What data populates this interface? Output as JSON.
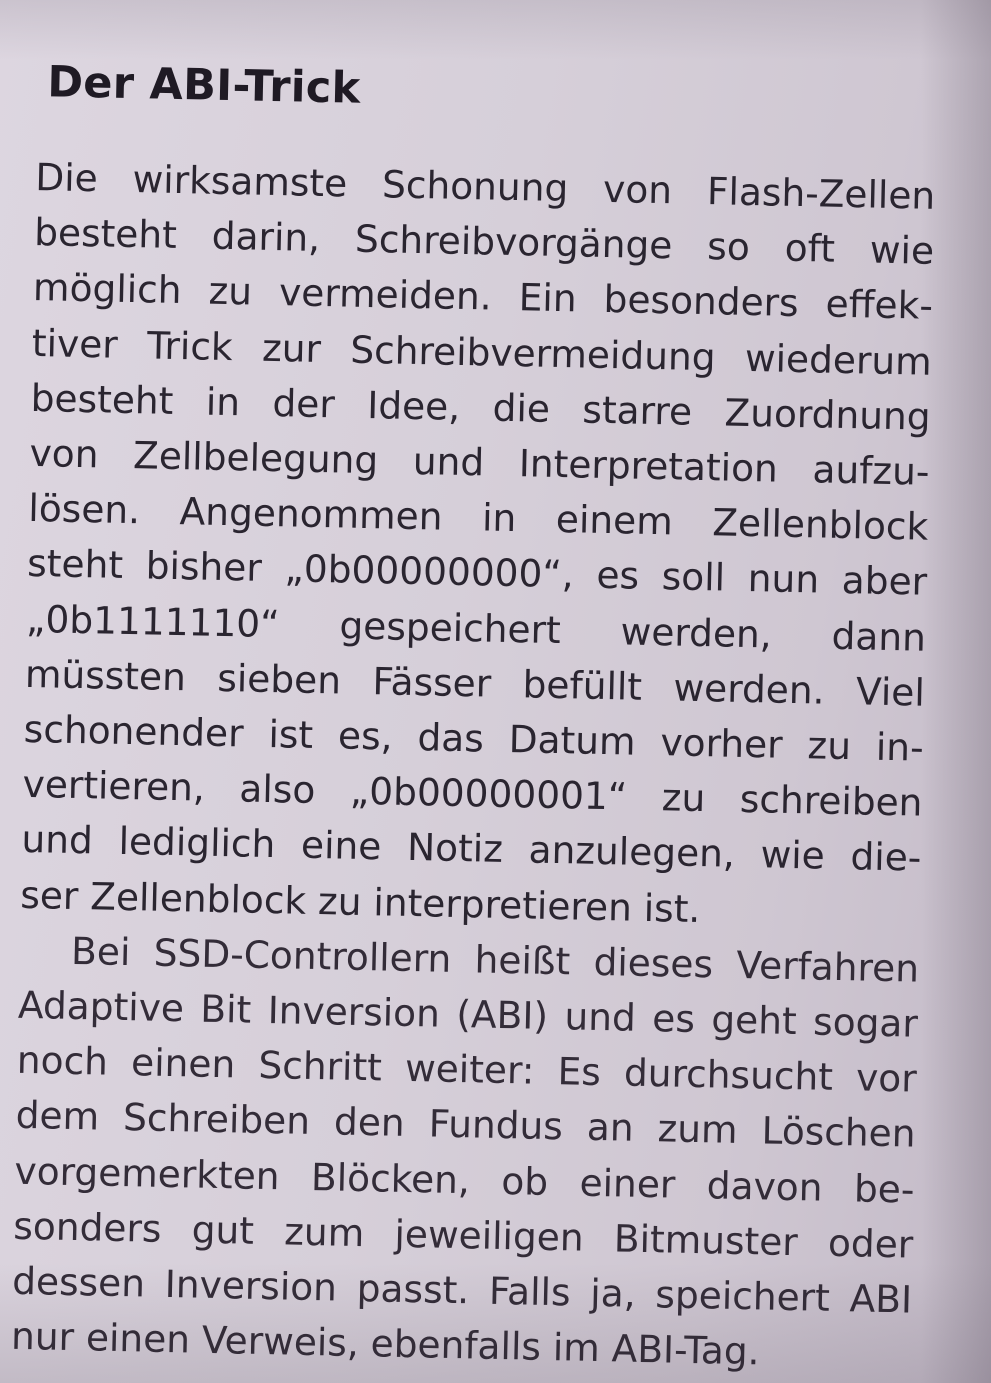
{
  "heading": "Der ABI-Trick",
  "paragraphs": [
    {
      "lines": [
        "Die wirksamste Schonung von Flash-Zellen",
        "besteht darin, Schreibvorgänge so oft wie",
        "möglich zu vermeiden. Ein besonders effek-",
        "tiver Trick zur Schreibvermeidung wiederum",
        "besteht in der Idee, die starre Zuordnung",
        "von Zellbelegung und Interpretation aufzu-",
        "lösen. Angenommen in einem Zellenblock",
        "steht bisher „0b00000000“, es soll nun aber",
        "„0b1111110“ gespeichert werden, dann",
        "müssten sieben Fässer befüllt werden. Viel",
        "schonender ist es, das Datum vorher zu in-",
        "vertieren, also „0b00000001“ zu schreiben",
        "und lediglich eine Notiz anzulegen, wie die-",
        "ser Zellenblock zu interpretieren ist."
      ]
    },
    {
      "lines": [
        "Bei SSD-Controllern heißt dieses Verfahren",
        "Adaptive Bit Inversion (ABI) und es geht sogar",
        "noch einen Schritt weiter: Es durchsucht vor",
        "dem Schreiben den Fundus an zum Löschen",
        "vorgemerkten Blöcken, ob einer davon be-",
        "sonders gut zum jeweiligen Bitmuster oder",
        "dessen Inversion passt. Falls ja, speichert ABI",
        "nur einen Verweis, ebenfalls im ABI-Tag."
      ]
    }
  ]
}
